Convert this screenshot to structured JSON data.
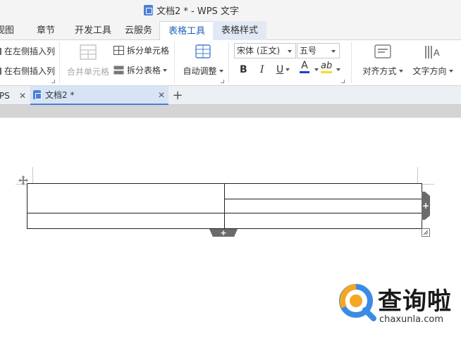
{
  "window": {
    "title": "文档2 * - WPS 文字"
  },
  "menu": {
    "tabs": [
      "视图",
      "章节",
      "开发工具",
      "云服务",
      "表格工具",
      "表格样式"
    ],
    "active": "表格工具"
  },
  "ribbon": {
    "insert_left_col": "在左侧插入列",
    "insert_right_col": "在右侧插入列",
    "merge_cells": "合并单元格",
    "split_cells": "拆分单元格",
    "split_table": "拆分表格",
    "auto_fit": "自动调整",
    "font_name": "宋体 (正文)",
    "font_size": "五号",
    "bold": "B",
    "italic": "I",
    "underline": "U",
    "font_color": "A",
    "highlight": "ab",
    "align": "对齐方式",
    "text_direction": "文字方向"
  },
  "doc_tabs": [
    {
      "label": "PS"
    },
    {
      "label": "文档2 *",
      "active": true
    }
  ],
  "watermark": {
    "brand": "查询啦",
    "url": "chaxunla.com"
  },
  "colors": {
    "accent": "#2062b8",
    "active_tab_bg": "#d6e4f5",
    "font_color_bar": "#1f3fd6",
    "highlight_bar": "#f0e020",
    "watermark_orange": "#f5a623",
    "watermark_blue": "#3b8ae6",
    "table_handle": "#6b6b6b"
  },
  "icons": [
    "doc-icon",
    "insert-col-icon",
    "merge-cells-icon",
    "split-cells-icon",
    "split-table-icon",
    "auto-fit-icon",
    "align-icon",
    "text-direction-icon",
    "close-icon",
    "plus-icon",
    "move-table-icon",
    "add-row-icon",
    "add-col-icon",
    "resize-icon"
  ]
}
